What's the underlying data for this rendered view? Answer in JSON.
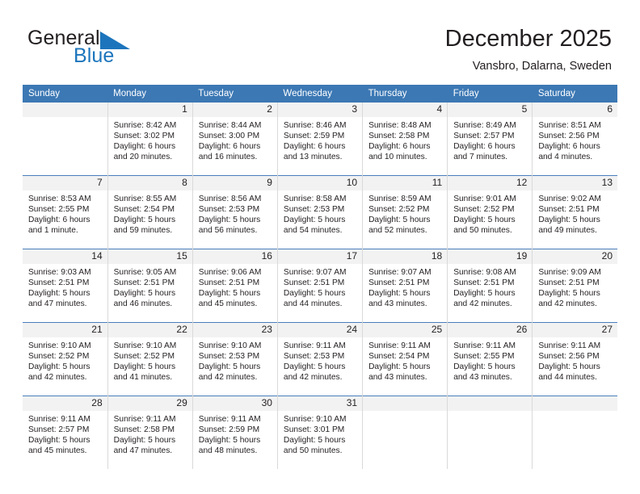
{
  "brand": {
    "name_part1": "General",
    "name_part2": "Blue",
    "logo_icon": "triangle-logo-icon",
    "accent_color": "#1c75bc"
  },
  "header": {
    "title": "December 2025",
    "subtitle": "Vansbro, Dalarna, Sweden"
  },
  "calendar": {
    "header_bg": "#3c78b4",
    "daynum_bg": "#f2f2f2",
    "weekday_headers": [
      "Sunday",
      "Monday",
      "Tuesday",
      "Wednesday",
      "Thursday",
      "Friday",
      "Saturday"
    ],
    "weeks": [
      [
        {
          "day": "",
          "lines": []
        },
        {
          "day": "1",
          "lines": [
            "Sunrise: 8:42 AM",
            "Sunset: 3:02 PM",
            "Daylight: 6 hours",
            "and 20 minutes."
          ]
        },
        {
          "day": "2",
          "lines": [
            "Sunrise: 8:44 AM",
            "Sunset: 3:00 PM",
            "Daylight: 6 hours",
            "and 16 minutes."
          ]
        },
        {
          "day": "3",
          "lines": [
            "Sunrise: 8:46 AM",
            "Sunset: 2:59 PM",
            "Daylight: 6 hours",
            "and 13 minutes."
          ]
        },
        {
          "day": "4",
          "lines": [
            "Sunrise: 8:48 AM",
            "Sunset: 2:58 PM",
            "Daylight: 6 hours",
            "and 10 minutes."
          ]
        },
        {
          "day": "5",
          "lines": [
            "Sunrise: 8:49 AM",
            "Sunset: 2:57 PM",
            "Daylight: 6 hours",
            "and 7 minutes."
          ]
        },
        {
          "day": "6",
          "lines": [
            "Sunrise: 8:51 AM",
            "Sunset: 2:56 PM",
            "Daylight: 6 hours",
            "and 4 minutes."
          ]
        }
      ],
      [
        {
          "day": "7",
          "lines": [
            "Sunrise: 8:53 AM",
            "Sunset: 2:55 PM",
            "Daylight: 6 hours",
            "and 1 minute."
          ]
        },
        {
          "day": "8",
          "lines": [
            "Sunrise: 8:55 AM",
            "Sunset: 2:54 PM",
            "Daylight: 5 hours",
            "and 59 minutes."
          ]
        },
        {
          "day": "9",
          "lines": [
            "Sunrise: 8:56 AM",
            "Sunset: 2:53 PM",
            "Daylight: 5 hours",
            "and 56 minutes."
          ]
        },
        {
          "day": "10",
          "lines": [
            "Sunrise: 8:58 AM",
            "Sunset: 2:53 PM",
            "Daylight: 5 hours",
            "and 54 minutes."
          ]
        },
        {
          "day": "11",
          "lines": [
            "Sunrise: 8:59 AM",
            "Sunset: 2:52 PM",
            "Daylight: 5 hours",
            "and 52 minutes."
          ]
        },
        {
          "day": "12",
          "lines": [
            "Sunrise: 9:01 AM",
            "Sunset: 2:52 PM",
            "Daylight: 5 hours",
            "and 50 minutes."
          ]
        },
        {
          "day": "13",
          "lines": [
            "Sunrise: 9:02 AM",
            "Sunset: 2:51 PM",
            "Daylight: 5 hours",
            "and 49 minutes."
          ]
        }
      ],
      [
        {
          "day": "14",
          "lines": [
            "Sunrise: 9:03 AM",
            "Sunset: 2:51 PM",
            "Daylight: 5 hours",
            "and 47 minutes."
          ]
        },
        {
          "day": "15",
          "lines": [
            "Sunrise: 9:05 AM",
            "Sunset: 2:51 PM",
            "Daylight: 5 hours",
            "and 46 minutes."
          ]
        },
        {
          "day": "16",
          "lines": [
            "Sunrise: 9:06 AM",
            "Sunset: 2:51 PM",
            "Daylight: 5 hours",
            "and 45 minutes."
          ]
        },
        {
          "day": "17",
          "lines": [
            "Sunrise: 9:07 AM",
            "Sunset: 2:51 PM",
            "Daylight: 5 hours",
            "and 44 minutes."
          ]
        },
        {
          "day": "18",
          "lines": [
            "Sunrise: 9:07 AM",
            "Sunset: 2:51 PM",
            "Daylight: 5 hours",
            "and 43 minutes."
          ]
        },
        {
          "day": "19",
          "lines": [
            "Sunrise: 9:08 AM",
            "Sunset: 2:51 PM",
            "Daylight: 5 hours",
            "and 42 minutes."
          ]
        },
        {
          "day": "20",
          "lines": [
            "Sunrise: 9:09 AM",
            "Sunset: 2:51 PM",
            "Daylight: 5 hours",
            "and 42 minutes."
          ]
        }
      ],
      [
        {
          "day": "21",
          "lines": [
            "Sunrise: 9:10 AM",
            "Sunset: 2:52 PM",
            "Daylight: 5 hours",
            "and 42 minutes."
          ]
        },
        {
          "day": "22",
          "lines": [
            "Sunrise: 9:10 AM",
            "Sunset: 2:52 PM",
            "Daylight: 5 hours",
            "and 41 minutes."
          ]
        },
        {
          "day": "23",
          "lines": [
            "Sunrise: 9:10 AM",
            "Sunset: 2:53 PM",
            "Daylight: 5 hours",
            "and 42 minutes."
          ]
        },
        {
          "day": "24",
          "lines": [
            "Sunrise: 9:11 AM",
            "Sunset: 2:53 PM",
            "Daylight: 5 hours",
            "and 42 minutes."
          ]
        },
        {
          "day": "25",
          "lines": [
            "Sunrise: 9:11 AM",
            "Sunset: 2:54 PM",
            "Daylight: 5 hours",
            "and 43 minutes."
          ]
        },
        {
          "day": "26",
          "lines": [
            "Sunrise: 9:11 AM",
            "Sunset: 2:55 PM",
            "Daylight: 5 hours",
            "and 43 minutes."
          ]
        },
        {
          "day": "27",
          "lines": [
            "Sunrise: 9:11 AM",
            "Sunset: 2:56 PM",
            "Daylight: 5 hours",
            "and 44 minutes."
          ]
        }
      ],
      [
        {
          "day": "28",
          "lines": [
            "Sunrise: 9:11 AM",
            "Sunset: 2:57 PM",
            "Daylight: 5 hours",
            "and 45 minutes."
          ]
        },
        {
          "day": "29",
          "lines": [
            "Sunrise: 9:11 AM",
            "Sunset: 2:58 PM",
            "Daylight: 5 hours",
            "and 47 minutes."
          ]
        },
        {
          "day": "30",
          "lines": [
            "Sunrise: 9:11 AM",
            "Sunset: 2:59 PM",
            "Daylight: 5 hours",
            "and 48 minutes."
          ]
        },
        {
          "day": "31",
          "lines": [
            "Sunrise: 9:10 AM",
            "Sunset: 3:01 PM",
            "Daylight: 5 hours",
            "and 50 minutes."
          ]
        },
        {
          "day": "",
          "lines": []
        },
        {
          "day": "",
          "lines": []
        },
        {
          "day": "",
          "lines": []
        }
      ]
    ]
  }
}
